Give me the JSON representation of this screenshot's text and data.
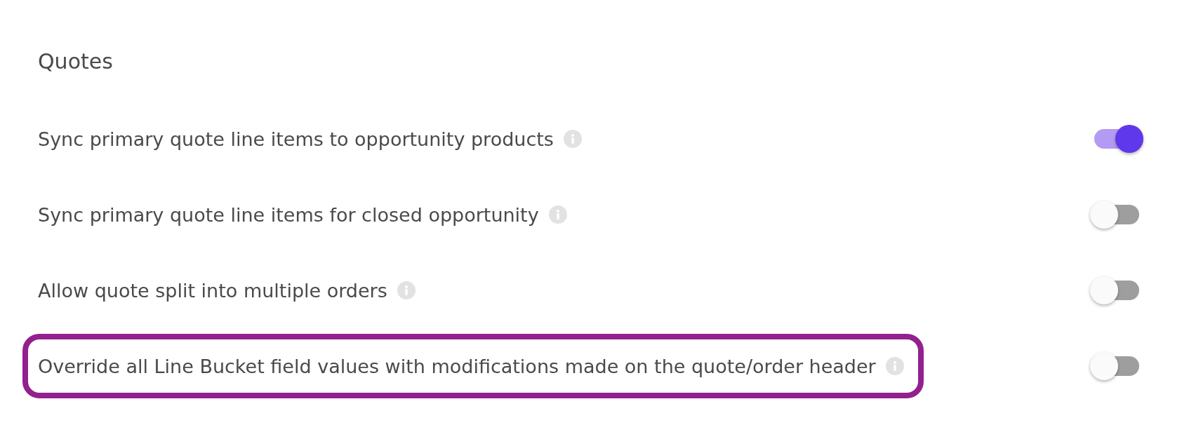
{
  "section": {
    "title": "Quotes"
  },
  "settings": [
    {
      "label": "Sync primary quote line items to opportunity products",
      "on": true,
      "highlighted": false
    },
    {
      "label": "Sync primary quote line items for closed opportunity",
      "on": false,
      "highlighted": false
    },
    {
      "label": "Allow quote split into multiple orders",
      "on": false,
      "highlighted": false
    },
    {
      "label": "Override all Line Bucket field values with modifications made on the quote/order header",
      "on": false,
      "highlighted": true
    }
  ]
}
